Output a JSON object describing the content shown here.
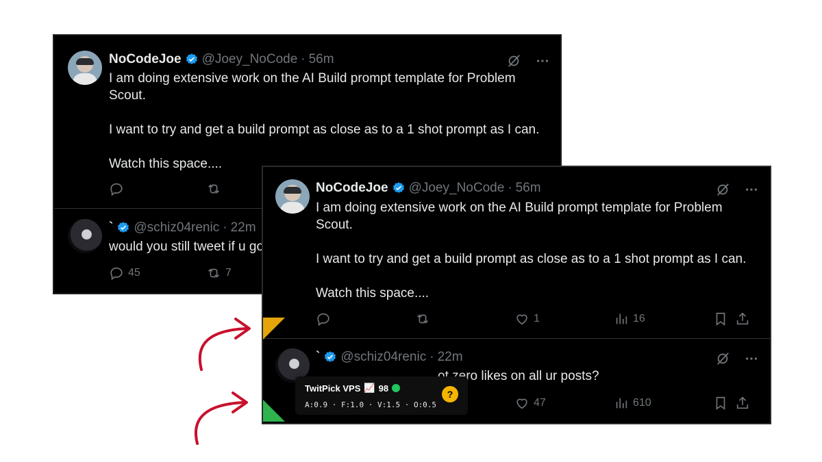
{
  "back_card": {
    "post": {
      "display_name": "NoCodeJoe",
      "handle": "@Joey_NoCode",
      "separator": "·",
      "time": "56m",
      "text": "I am doing extensive work on the AI Build prompt template for Problem\nScout.\n\nI want to try and get a build prompt as close as to a 1 shot prompt as I can.\n\nWatch this space...."
    },
    "reply": {
      "display_name": "`",
      "handle": "@schiz04renic",
      "separator": "·",
      "time": "22m",
      "text": "would you still tweet if u go",
      "reply_count": "45",
      "repost_count": "7"
    }
  },
  "front_card": {
    "post": {
      "display_name": "NoCodeJoe",
      "handle": "@Joey_NoCode",
      "separator": "·",
      "time": "56m",
      "text": "I am doing extensive work on the AI Build prompt template for Problem\nScout.\n\nI want to try and get a build prompt as close as to a 1 shot prompt as I can.\n\nWatch this space....",
      "like_count": "1",
      "view_count": "16"
    },
    "reply": {
      "display_name": "`",
      "handle": "@schiz04renic",
      "separator": "·",
      "time": "22m",
      "text_visible": "ot zero likes on all ur posts?",
      "like_count": "47",
      "view_count": "610"
    }
  },
  "popup": {
    "title": "TwitPick VPS",
    "chart_emoji": "📈",
    "score": "98",
    "metrics": "A:0.9 · F:1.0 · V:1.5 · O:0.5",
    "help": "?"
  },
  "colors": {
    "verified": "#1d9bf0",
    "gutter_top": "#e5a50a",
    "gutter_bottom": "#2fb34d",
    "arrow": "#c8102e",
    "help_badge": "#f4b400"
  }
}
